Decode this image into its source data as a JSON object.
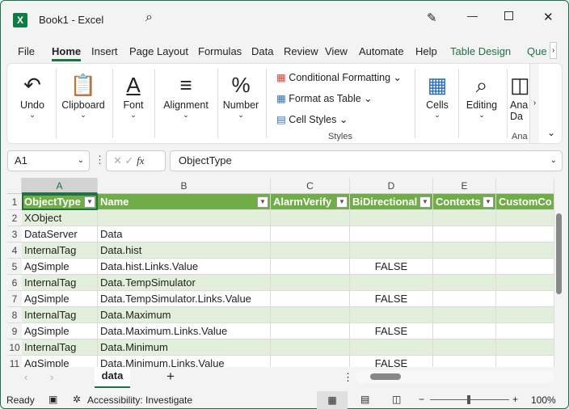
{
  "app": {
    "title": "Book1 - Excel",
    "logo": "X"
  },
  "tabs": [
    "File",
    "Home",
    "Insert",
    "Page Layout",
    "Formulas",
    "Data",
    "Review",
    "View",
    "Automate",
    "Help",
    "Table Design",
    "Que"
  ],
  "ribbon": {
    "undo": "Undo",
    "clipboard": "Clipboard",
    "font": "Font",
    "alignment": "Alignment",
    "number": "Number",
    "conditional_formatting": "Conditional Formatting",
    "format_as_table": "Format as Table",
    "cell_styles": "Cell Styles",
    "styles": "Styles",
    "cells": "Cells",
    "editing": "Editing",
    "analyze": "Ana Da",
    "analyze_group": "Ana"
  },
  "formula_bar": {
    "name_box": "A1",
    "fx": "fx",
    "value": "ObjectType"
  },
  "columns": [
    "A",
    "B",
    "C",
    "D",
    "E"
  ],
  "headers": [
    "ObjectType",
    "Name",
    "AlarmVerify",
    "BiDirectional",
    "Contexts",
    "CustomCo"
  ],
  "rows": [
    {
      "n": "1"
    },
    {
      "n": "2",
      "a": "XObject",
      "b": "",
      "d": ""
    },
    {
      "n": "3",
      "a": "DataServer",
      "b": "Data",
      "d": ""
    },
    {
      "n": "4",
      "a": "InternalTag",
      "b": "Data.hist",
      "d": ""
    },
    {
      "n": "5",
      "a": "AgSimple",
      "b": "Data.hist.Links.Value",
      "d": "FALSE"
    },
    {
      "n": "6",
      "a": "InternalTag",
      "b": "Data.TempSimulator",
      "d": ""
    },
    {
      "n": "7",
      "a": "AgSimple",
      "b": "Data.TempSimulator.Links.Value",
      "d": "FALSE"
    },
    {
      "n": "8",
      "a": "InternalTag",
      "b": "Data.Maximum",
      "d": ""
    },
    {
      "n": "9",
      "a": "AgSimple",
      "b": "Data.Maximum.Links.Value",
      "d": "FALSE"
    },
    {
      "n": "10",
      "a": "InternalTag",
      "b": "Data.Minimum",
      "d": ""
    },
    {
      "n": "11",
      "a": "AgSimple",
      "b": "Data.Minimum.Links.Value",
      "d": "FALSE"
    }
  ],
  "sheet_tab": "data",
  "status": {
    "ready": "Ready",
    "accessibility": "Accessibility: Investigate",
    "zoom": "100%",
    "zoom_level": 100
  },
  "colors": {
    "accent": "#1e7145",
    "header": "#70ad47",
    "band": "#e2efda"
  }
}
